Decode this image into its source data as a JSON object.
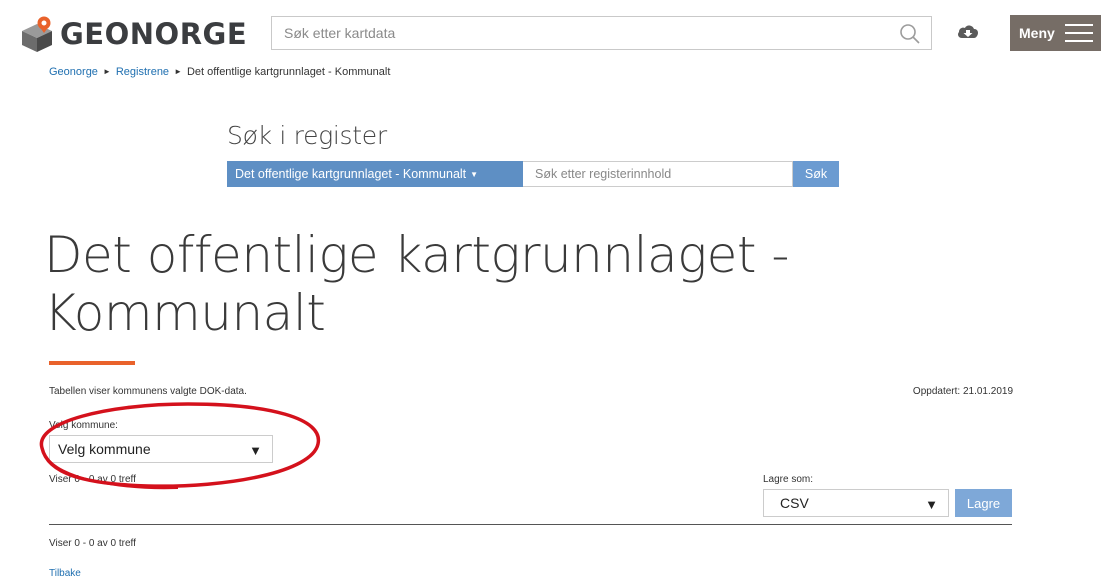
{
  "header": {
    "logo_text": "GEONORGE",
    "search_placeholder": "Søk etter kartdata",
    "menu_label": "Meny",
    "icons": [
      "geonorge-logo-icon",
      "search-icon",
      "cloud-download-icon",
      "hamburger-icon"
    ]
  },
  "breadcrumb": {
    "items": [
      "Geonorge",
      "Registrene"
    ],
    "current": "Det offentlige kartgrunnlaget - Kommunalt",
    "separator": "►"
  },
  "register_search": {
    "title": "Søk i register",
    "dropdown_label": "Det offentlige kartgrunnlaget - Kommunalt",
    "input_placeholder": "Søk etter registerinnhold",
    "button_label": "Søk"
  },
  "page": {
    "title_line1": "Det offentlige kartgrunnlaget -",
    "title_line2": "Kommunalt",
    "description": "Tabellen viser kommunens valgte DOK-data.",
    "updated": "Oppdatert: 21.01.2019"
  },
  "filter": {
    "kommune_label": "Velg kommune:",
    "kommune_value": "Velg kommune",
    "result_count": "Viser 0 - 0 av 0 treff"
  },
  "export": {
    "label": "Lagre som:",
    "format_value": "CSV",
    "button_label": "Lagre"
  },
  "footer": {
    "result_count": "Viser 0 - 0 av 0 treff",
    "back_link": "Tilbake"
  },
  "colors": {
    "accent_orange": "#e9622b",
    "primary_blue": "#5e8fc4",
    "button_blue": "#7ea8d8",
    "menu_brown": "#766d66",
    "annotation_red": "#d4111c"
  }
}
